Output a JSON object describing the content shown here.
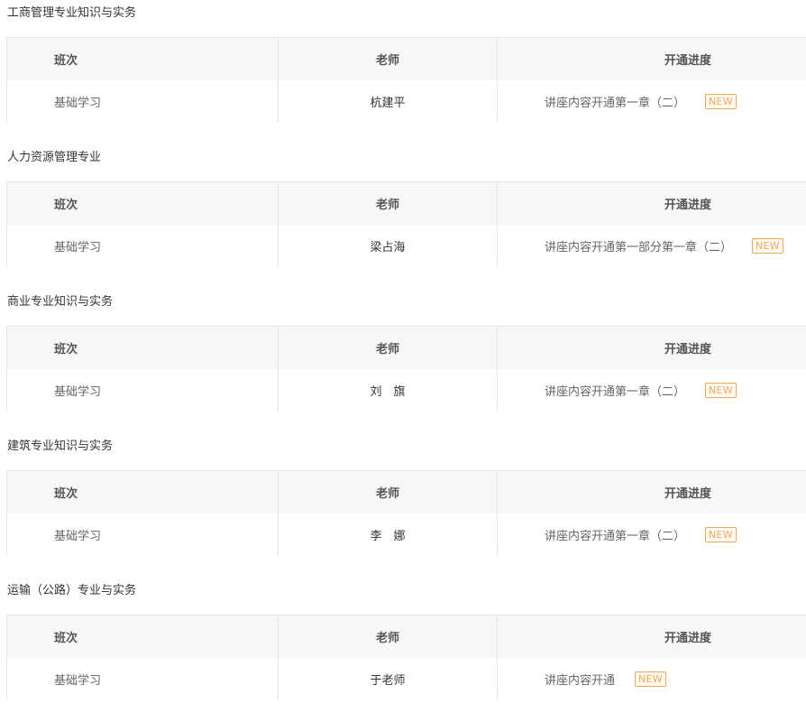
{
  "sections": [
    {
      "title": "工商管理专业知识与实务",
      "headers": {
        "class": "班次",
        "teacher": "老师",
        "progress": "开通进度"
      },
      "row": {
        "class": "基础学习",
        "teacher": "杭建平",
        "progress": "讲座内容开通第一章（二）",
        "badge": "NEW"
      }
    },
    {
      "title": "人力资源管理专业",
      "headers": {
        "class": "班次",
        "teacher": "老师",
        "progress": "开通进度"
      },
      "row": {
        "class": "基础学习",
        "teacher": "梁占海",
        "progress": "讲座内容开通第一部分第一章（二）",
        "badge": "NEW"
      }
    },
    {
      "title": "商业专业知识与实务",
      "headers": {
        "class": "班次",
        "teacher": "老师",
        "progress": "开通进度"
      },
      "row": {
        "class": "基础学习",
        "teacher": "刘　旗",
        "progress": "讲座内容开通第一章（二）",
        "badge": "NEW"
      }
    },
    {
      "title": "建筑专业知识与实务",
      "headers": {
        "class": "班次",
        "teacher": "老师",
        "progress": "开通进度"
      },
      "row": {
        "class": "基础学习",
        "teacher": "李　娜",
        "progress": "讲座内容开通第一章（二）",
        "badge": "NEW"
      }
    },
    {
      "title": "运输（公路）专业与实务",
      "headers": {
        "class": "班次",
        "teacher": "老师",
        "progress": "开通进度"
      },
      "row": {
        "class": "基础学习",
        "teacher": "于老师",
        "progress": "讲座内容开通",
        "badge": "NEW"
      }
    }
  ]
}
